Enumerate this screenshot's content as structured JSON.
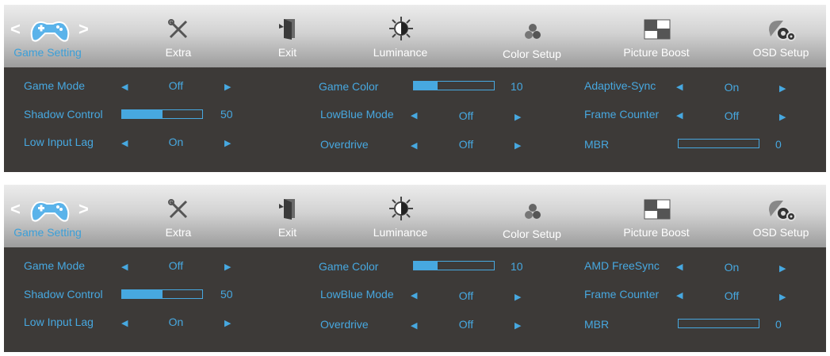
{
  "panels": [
    {
      "tabs": [
        {
          "label": "Game Setting",
          "icon": "gamepad-icon"
        },
        {
          "label": "Extra",
          "icon": "tools-icon"
        },
        {
          "label": "Exit",
          "icon": "exit-door-icon"
        },
        {
          "label": "Luminance",
          "icon": "sun-icon"
        },
        {
          "label": "Color Setup",
          "icon": "color-balls-icon"
        },
        {
          "label": "Picture Boost",
          "icon": "picture-boost-icon"
        },
        {
          "label": "OSD Setup",
          "icon": "osd-gears-icon"
        }
      ],
      "nav": {
        "left": "<",
        "right": ">"
      },
      "col1": {
        "game_mode": {
          "label": "Game Mode",
          "value": "Off"
        },
        "shadow_control": {
          "label": "Shadow Control",
          "value": "50",
          "level": 0.5
        },
        "low_input_lag": {
          "label": "Low Input Lag",
          "value": "On"
        }
      },
      "col2": {
        "game_color": {
          "label": "Game Color",
          "value": "10",
          "level": 0.3
        },
        "lowblue_mode": {
          "label": "LowBlue Mode",
          "value": "Off"
        },
        "overdrive": {
          "label": "Overdrive",
          "value": "Off"
        }
      },
      "col3": {
        "sync": {
          "label": "Adaptive-Sync",
          "value": "On"
        },
        "frame_counter": {
          "label": "Frame Counter",
          "value": "Off"
        },
        "mbr": {
          "label": "MBR",
          "value": "0",
          "level": 0
        }
      },
      "arrows": {
        "left": "◀",
        "right": "▶"
      }
    },
    {
      "tabs": [
        {
          "label": "Game Setting",
          "icon": "gamepad-icon"
        },
        {
          "label": "Extra",
          "icon": "tools-icon"
        },
        {
          "label": "Exit",
          "icon": "exit-door-icon"
        },
        {
          "label": "Luminance",
          "icon": "sun-icon"
        },
        {
          "label": "Color Setup",
          "icon": "color-balls-icon"
        },
        {
          "label": "Picture Boost",
          "icon": "picture-boost-icon"
        },
        {
          "label": "OSD Setup",
          "icon": "osd-gears-icon"
        }
      ],
      "nav": {
        "left": "<",
        "right": ">"
      },
      "col1": {
        "game_mode": {
          "label": "Game Mode",
          "value": "Off"
        },
        "shadow_control": {
          "label": "Shadow Control",
          "value": "50",
          "level": 0.5
        },
        "low_input_lag": {
          "label": "Low Input Lag",
          "value": "On"
        }
      },
      "col2": {
        "game_color": {
          "label": "Game Color",
          "value": "10",
          "level": 0.3
        },
        "lowblue_mode": {
          "label": "LowBlue Mode",
          "value": "Off"
        },
        "overdrive": {
          "label": "Overdrive",
          "value": "Off"
        }
      },
      "col3": {
        "sync": {
          "label": "AMD FreeSync",
          "value": "On"
        },
        "frame_counter": {
          "label": "Frame Counter",
          "value": "Off"
        },
        "mbr": {
          "label": "MBR",
          "value": "0",
          "level": 0
        }
      },
      "arrows": {
        "left": "◀",
        "right": "▶"
      }
    }
  ],
  "colors": {
    "accent": "#47a8e0",
    "body_bg": "#3d3a38",
    "tab_text": "#ffffff"
  }
}
